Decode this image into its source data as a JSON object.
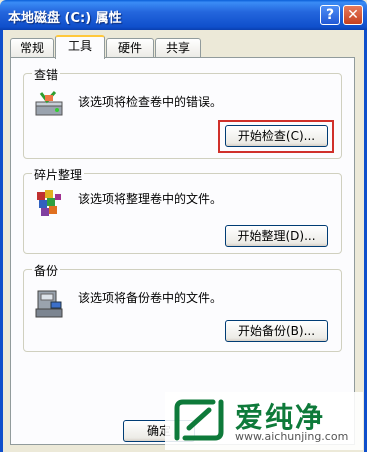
{
  "window": {
    "title": "本地磁盘 (C:) 属性",
    "help_label": "?",
    "close_label": "✕"
  },
  "tabs": [
    {
      "label": "常规"
    },
    {
      "label": "工具"
    },
    {
      "label": "硬件"
    },
    {
      "label": "共享"
    }
  ],
  "groups": [
    {
      "title": "查错",
      "description": "该选项将检查卷中的错误。",
      "button": "开始检查(C)...",
      "icon": "disk-check-icon"
    },
    {
      "title": "碎片整理",
      "description": "该选项将整理卷中的文件。",
      "button": "开始整理(D)...",
      "icon": "defrag-icon"
    },
    {
      "title": "备份",
      "description": "该选项将备份卷中的文件。",
      "button": "开始备份(B)...",
      "icon": "backup-icon"
    }
  ],
  "footer": {
    "ok_label": "确定"
  },
  "watermark": {
    "text": "爱纯净",
    "url": "www.aichunjing.com"
  },
  "colors": {
    "highlight": "#D0302A",
    "titlebar": "#0F4FCB",
    "watermark": "#0E7A3A"
  }
}
